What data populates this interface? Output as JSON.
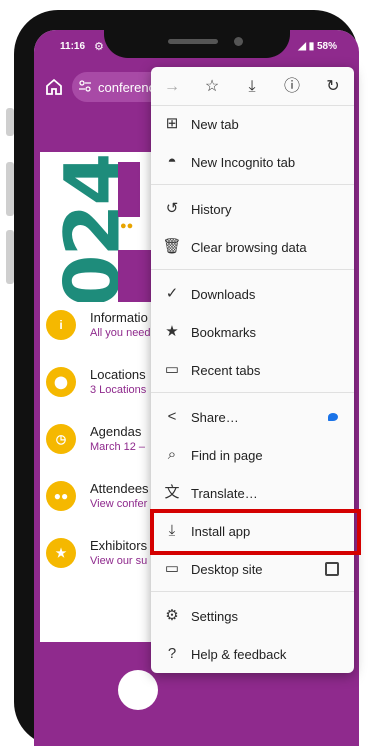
{
  "status_bar": {
    "time": "11:16",
    "battery": "58%"
  },
  "toolbar": {
    "url": "conferenc"
  },
  "hero": {
    "year": "2024"
  },
  "list_items": [
    {
      "title": "Informatio",
      "subtitle": "All you need",
      "icon": "info-icon"
    },
    {
      "title": "Locations",
      "subtitle": "3 Locations",
      "icon": "location-pin-icon"
    },
    {
      "title": "Agendas",
      "subtitle": "March 12 –",
      "icon": "clock-icon"
    },
    {
      "title": "Attendees",
      "subtitle": "View confer",
      "icon": "people-icon"
    },
    {
      "title": "Exhibitors",
      "subtitle": "View our su",
      "icon": "star-icon"
    }
  ],
  "menu": {
    "top_icons": [
      "forward-icon",
      "bookmark-star-icon",
      "download-icon",
      "info-icon",
      "reload-icon"
    ],
    "items": [
      {
        "label": "New tab",
        "icon": "new-tab-icon"
      },
      {
        "label": "New Incognito tab",
        "icon": "incognito-icon"
      },
      {
        "label": "History",
        "icon": "history-icon"
      },
      {
        "label": "Clear browsing data",
        "icon": "trash-icon"
      },
      {
        "label": "Downloads",
        "icon": "downloads-icon"
      },
      {
        "label": "Bookmarks",
        "icon": "bookmarks-icon"
      },
      {
        "label": "Recent tabs",
        "icon": "recent-tabs-icon"
      },
      {
        "label": "Share…",
        "icon": "share-icon"
      },
      {
        "label": "Find in page",
        "icon": "find-in-page-icon"
      },
      {
        "label": "Translate…",
        "icon": "translate-icon"
      },
      {
        "label": "Install app",
        "icon": "install-app-icon"
      },
      {
        "label": "Desktop site",
        "icon": "desktop-icon"
      },
      {
        "label": "Settings",
        "icon": "settings-icon"
      },
      {
        "label": "Help & feedback",
        "icon": "help-icon"
      }
    ]
  },
  "colors": {
    "brand": "#8f2a8d",
    "accent": "#f5b800",
    "teal": "#1e8c7b",
    "highlight": "#d40000"
  }
}
